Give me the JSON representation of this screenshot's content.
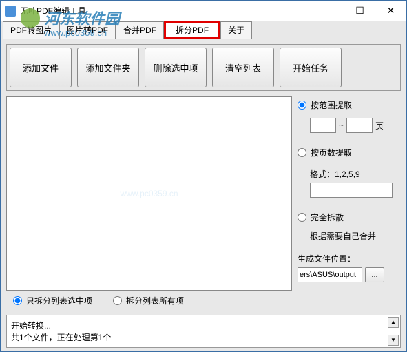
{
  "window": {
    "title": "无叶PDF编辑工具"
  },
  "tabs": {
    "items": [
      {
        "label": "PDF转图片"
      },
      {
        "label": "图片转PDF"
      },
      {
        "label": "合并PDF"
      },
      {
        "label": "拆分PDF",
        "active": true
      },
      {
        "label": "关于"
      }
    ]
  },
  "toolbar": {
    "add_file": "添加文件",
    "add_folder": "添加文件夹",
    "remove_sel": "删除选中项",
    "clear": "清空列表",
    "start": "开始任务"
  },
  "side": {
    "by_range": "按范围提取",
    "range_from": "",
    "range_sep": "~",
    "range_to": "",
    "range_unit": "页",
    "by_pages": "按页数提取",
    "fmt_label": "格式：1,2,5,9",
    "fmt_value": "",
    "full_split": "完全拆散",
    "full_note": "根据需要自己合并",
    "loc_label": "生成文件位置：",
    "loc_value": "ers\\ASUS\\output",
    "browse": "..."
  },
  "bottom": {
    "only_sel": "只拆分列表选中项",
    "all": "拆分列表所有项"
  },
  "log": {
    "line1": "开始转换...",
    "line2": "共1个文件，正在处理第1个"
  },
  "watermark": {
    "text": "河东软件园",
    "url": "www.pc0359.cn"
  }
}
